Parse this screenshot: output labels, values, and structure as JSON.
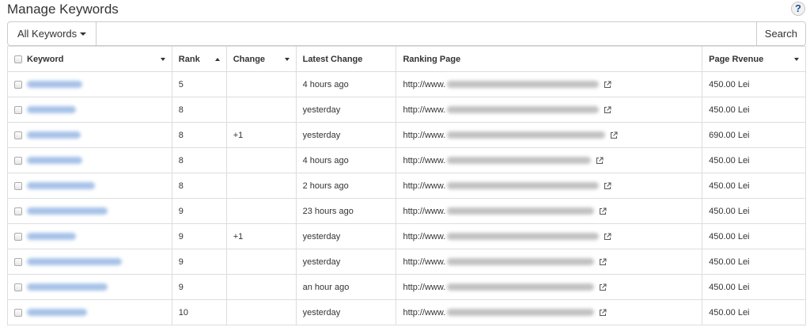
{
  "header": {
    "title": "Manage Keywords",
    "help_label": "?"
  },
  "toolbar": {
    "filter_label": "All Keywords",
    "search_value": "",
    "search_placeholder": "",
    "search_button": "Search"
  },
  "table": {
    "columns": [
      "Keyword",
      "Rank",
      "Change",
      "Latest Change",
      "Ranking Page",
      "Page Rvenue"
    ],
    "rows": [
      {
        "rank": "5",
        "change": "",
        "latest": "4 hours ago",
        "url": "http://www.",
        "revenue": "450.00 Lei"
      },
      {
        "rank": "8",
        "change": "",
        "latest": "yesterday",
        "url": "http://www.",
        "revenue": "450.00 Lei"
      },
      {
        "rank": "8",
        "change": "+1",
        "latest": "yesterday",
        "url": "http://www.",
        "revenue": "690.00 Lei"
      },
      {
        "rank": "8",
        "change": "",
        "latest": "4 hours ago",
        "url": "http://www.",
        "revenue": "450.00 Lei"
      },
      {
        "rank": "8",
        "change": "",
        "latest": "2 hours ago",
        "url": "http://www.",
        "revenue": "450.00 Lei"
      },
      {
        "rank": "9",
        "change": "",
        "latest": "23 hours ago",
        "url": "http://www.",
        "revenue": "450.00 Lei"
      },
      {
        "rank": "9",
        "change": "+1",
        "latest": "yesterday",
        "url": "http://www.",
        "revenue": "450.00 Lei"
      },
      {
        "rank": "9",
        "change": "",
        "latest": "yesterday",
        "url": "http://www.",
        "revenue": "450.00 Lei"
      },
      {
        "rank": "9",
        "change": "",
        "latest": "an hour ago",
        "url": "http://www.",
        "revenue": "450.00 Lei"
      },
      {
        "rank": "10",
        "change": "",
        "latest": "yesterday",
        "url": "http://www.",
        "revenue": "450.00 Lei"
      }
    ]
  },
  "icons": {
    "help": "help-icon",
    "external_link": "external-link-icon",
    "caret": "caret-down-icon"
  },
  "colors": {
    "link_blue": "#a7c2e8",
    "help_blue": "#1f4f96",
    "border": "#dddddd"
  }
}
